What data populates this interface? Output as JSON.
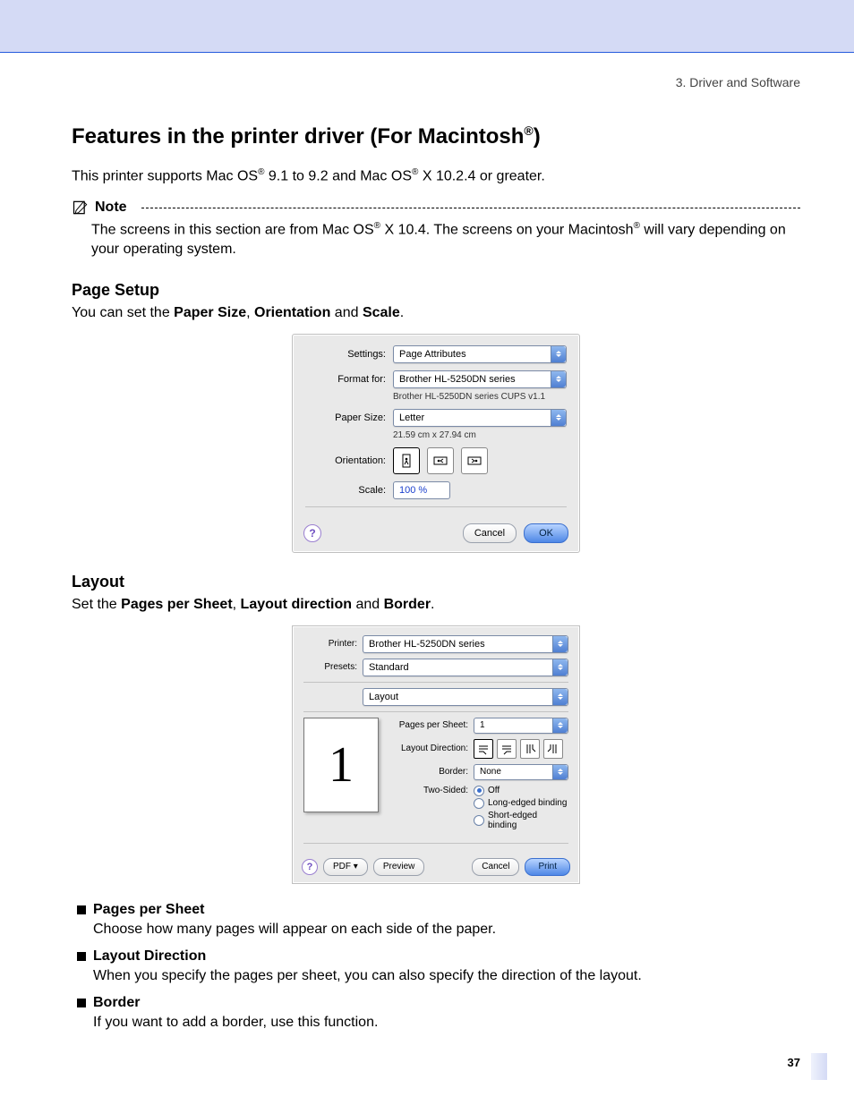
{
  "header": {
    "crumb": "3. Driver and Software"
  },
  "h1": {
    "pre": "Features in the printer driver (For Macintosh",
    "sup": "®",
    "post": ")"
  },
  "intro": {
    "a": "This printer supports Mac OS",
    "sup1": "®",
    "b": " 9.1 to 9.2 and Mac OS",
    "sup2": "®",
    "c": " X 10.2.4 or greater."
  },
  "note": {
    "label": "Note",
    "a": "The screens in this section are from Mac OS",
    "sup1": "®",
    "b": " X 10.4. The screens on your Macintosh",
    "sup2": "®",
    "c": " will vary depending on your operating system."
  },
  "page_setup": {
    "heading": "Page Setup",
    "pre": "You can set the ",
    "b1": "Paper Size",
    "mid1": ", ",
    "b2": "Orientation",
    "mid2": " and ",
    "b3": "Scale",
    "post": "."
  },
  "dlg1": {
    "settings_label": "Settings:",
    "settings_value": "Page Attributes",
    "format_label": "Format for:",
    "format_value": "Brother HL-5250DN series",
    "format_sub": "Brother HL-5250DN series CUPS v1.1",
    "paper_label": "Paper Size:",
    "paper_value": "Letter",
    "paper_sub": "21.59 cm x 27.94 cm",
    "orient_label": "Orientation:",
    "scale_label": "Scale:",
    "scale_value": "100 %",
    "help": "?",
    "cancel": "Cancel",
    "ok": "OK"
  },
  "layout": {
    "heading": "Layout",
    "pre": "Set the ",
    "b1": "Pages per Sheet",
    "mid1": ", ",
    "b2": "Layout direction",
    "mid2": " and ",
    "b3": "Border",
    "post": "."
  },
  "dlg2": {
    "printer_label": "Printer:",
    "printer_value": "Brother HL-5250DN series",
    "presets_label": "Presets:",
    "presets_value": "Standard",
    "mode_value": "Layout",
    "pps_label": "Pages per Sheet:",
    "pps_value": "1",
    "ld_label": "Layout Direction:",
    "border_label": "Border:",
    "border_value": "None",
    "ts_label": "Two-Sided:",
    "ts_off": "Off",
    "ts_long": "Long-edged binding",
    "ts_short": "Short-edged binding",
    "preview_digit": "1",
    "help": "?",
    "pdf": "PDF ▾",
    "preview": "Preview",
    "cancel": "Cancel",
    "print": "Print"
  },
  "bullets": {
    "pps": {
      "head": "Pages per Sheet",
      "body": "Choose how many pages will appear on each side of the paper."
    },
    "ld": {
      "head": "Layout Direction",
      "body": "When you specify the pages per sheet, you can also specify the direction of the layout."
    },
    "bd": {
      "head": "Border",
      "body": "If you want to add a border, use this function."
    }
  },
  "page_number": "37"
}
